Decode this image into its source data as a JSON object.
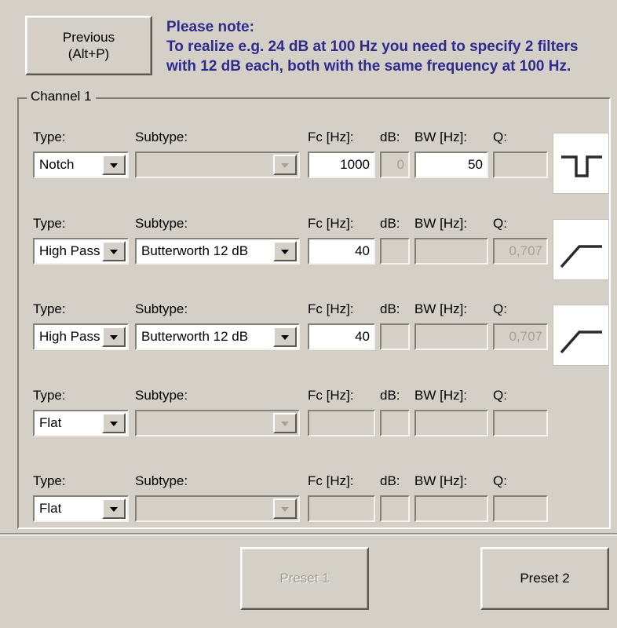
{
  "accent_color": "#2f2b8c",
  "background_color": "#d4d0c8",
  "toolbar": {
    "previous_label": "Previous\n(Alt+P)"
  },
  "note": {
    "text": "Please note:\nTo realize e.g. 24 dB at 100 Hz you need to specify 2 filters with 12 dB each, both with the same frequency at 100 Hz."
  },
  "group": {
    "title": "Channel 1"
  },
  "column_headers": {
    "type": "Type:",
    "subtype": "Subtype:",
    "fc": "Fc [Hz]:",
    "db": "dB:",
    "bw": "BW [Hz]:",
    "q": "Q:"
  },
  "rows": [
    {
      "type": "Notch",
      "type_disabled": false,
      "subtype": "",
      "subtype_disabled": true,
      "fc": "1000",
      "fc_disabled": false,
      "db": "0",
      "db_disabled": true,
      "bw": "50",
      "bw_disabled": false,
      "q": "",
      "q_disabled": true,
      "icon": "notch-response-icon"
    },
    {
      "type": "High Pass",
      "type_disabled": false,
      "subtype": "Butterworth 12 dB",
      "subtype_disabled": false,
      "fc": "40",
      "fc_disabled": false,
      "db": "",
      "db_disabled": true,
      "bw": "",
      "bw_disabled": true,
      "q": "0,707",
      "q_disabled": true,
      "icon": "highpass-response-icon"
    },
    {
      "type": "High Pass",
      "type_disabled": false,
      "subtype": "Butterworth 12 dB",
      "subtype_disabled": false,
      "fc": "40",
      "fc_disabled": false,
      "db": "",
      "db_disabled": true,
      "bw": "",
      "bw_disabled": true,
      "q": "0,707",
      "q_disabled": true,
      "icon": "highpass-response-icon"
    },
    {
      "type": "Flat",
      "type_disabled": false,
      "subtype": "",
      "subtype_disabled": true,
      "fc": "",
      "fc_disabled": true,
      "db": "",
      "db_disabled": true,
      "bw": "",
      "bw_disabled": true,
      "q": "",
      "q_disabled": true,
      "icon": "none"
    },
    {
      "type": "Flat",
      "type_disabled": false,
      "subtype": "",
      "subtype_disabled": true,
      "fc": "",
      "fc_disabled": true,
      "db": "",
      "db_disabled": true,
      "bw": "",
      "bw_disabled": true,
      "q": "",
      "q_disabled": true,
      "icon": "none"
    }
  ],
  "footer": {
    "preset1_label": "Preset 1",
    "preset1_disabled": true,
    "preset2_label": "Preset 2",
    "preset2_disabled": false
  }
}
